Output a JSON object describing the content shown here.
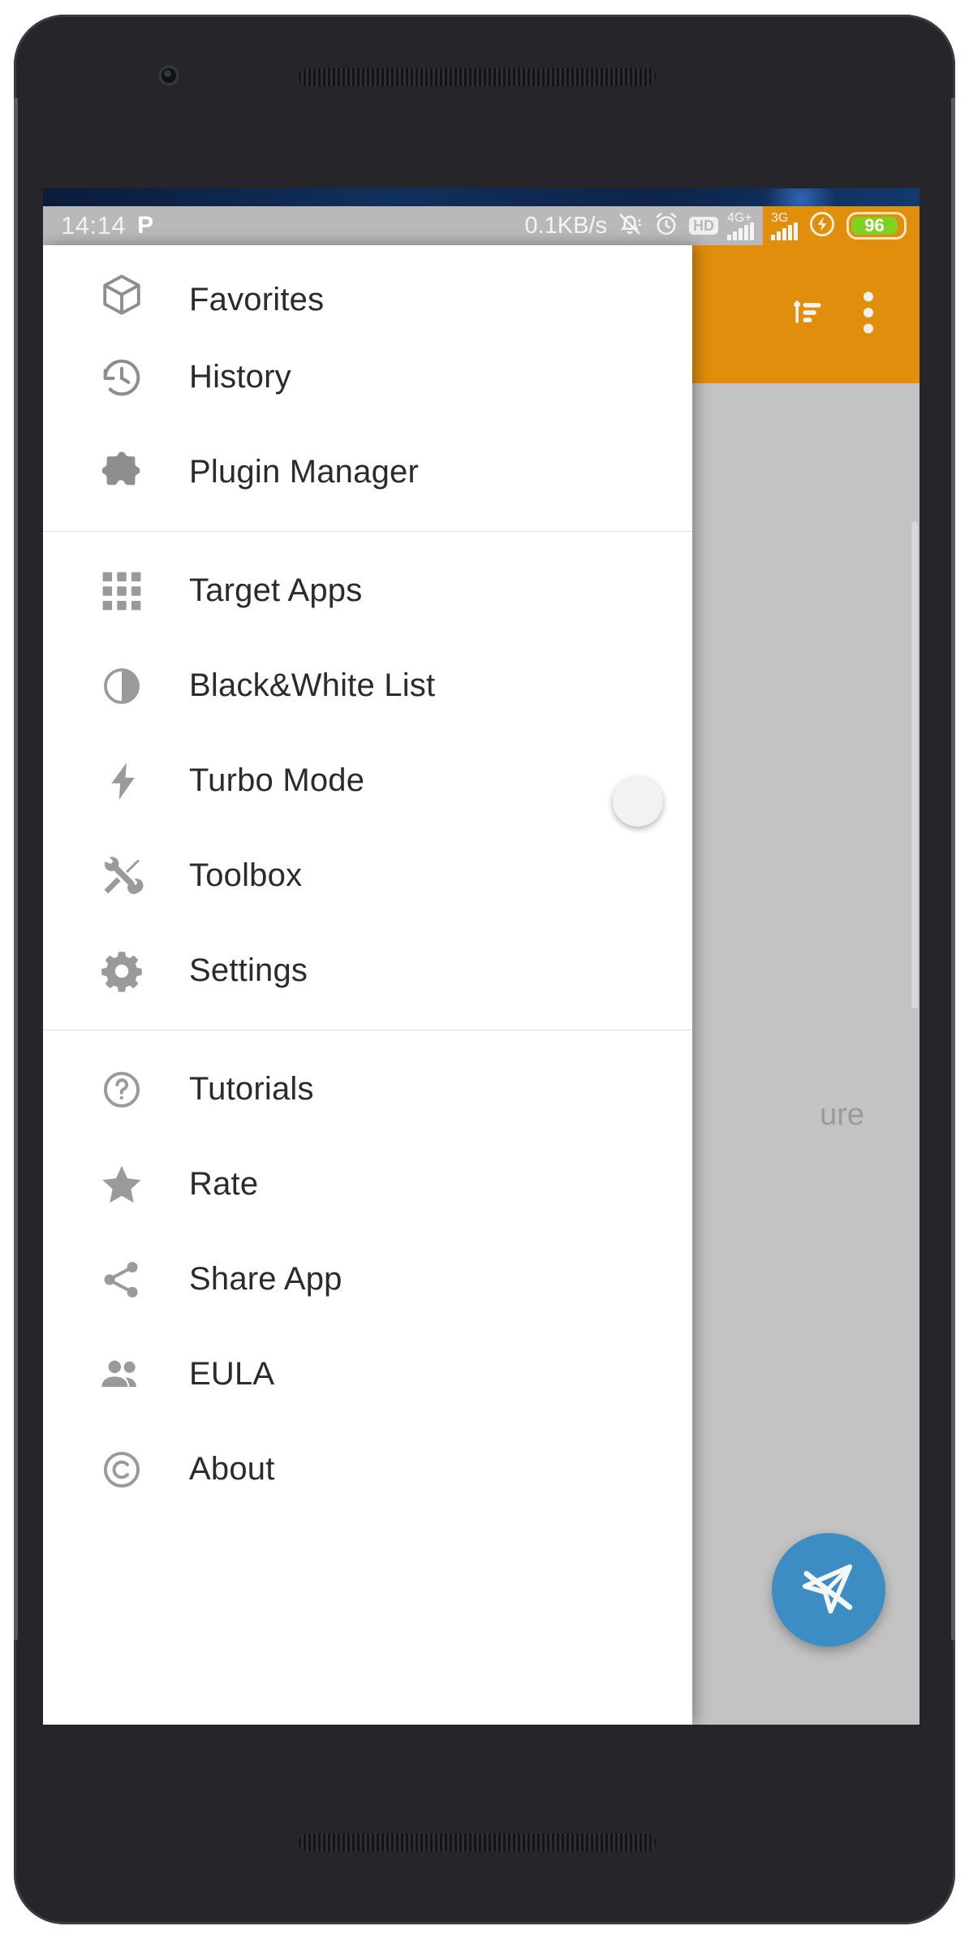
{
  "statusbar": {
    "time": "14:14",
    "pico_icon": "P",
    "network_speed": "0.1KB/s",
    "mute_icon": "bell-muted-icon",
    "alarm_icon": "alarm-clock-icon",
    "hd_label": "HD",
    "sim1_label": "4G+",
    "sim2_label": "3G",
    "charging_icon": "charging-bolt-icon",
    "battery_percent": "96",
    "battery_color": "#7ed321"
  },
  "appbar": {
    "background": "#e08e0b",
    "sort_icon": "sort-filter-icon",
    "overflow_icon": "more-vertical-icon"
  },
  "content": {
    "ghost_text": "ure",
    "fab_icon": "send-disabled-icon",
    "fab_color": "#3b8dc4"
  },
  "drawer": {
    "groups": [
      {
        "items": [
          {
            "label": "Favorites",
            "icon": "cube-icon"
          },
          {
            "label": "History",
            "icon": "history-clock-icon"
          },
          {
            "label": "Plugin Manager",
            "icon": "puzzle-piece-icon"
          }
        ]
      },
      {
        "items": [
          {
            "label": "Target Apps",
            "icon": "grid-apps-icon"
          },
          {
            "label": "Black&White List",
            "icon": "contrast-circle-icon"
          },
          {
            "label": "Turbo Mode",
            "icon": "lightning-bolt-icon",
            "toggle": "off"
          },
          {
            "label": "Toolbox",
            "icon": "tools-icon"
          },
          {
            "label": "Settings",
            "icon": "gear-icon"
          }
        ]
      },
      {
        "items": [
          {
            "label": "Tutorials",
            "icon": "help-circle-icon"
          },
          {
            "label": "Rate",
            "icon": "star-icon"
          },
          {
            "label": "Share App",
            "icon": "share-icon"
          },
          {
            "label": "EULA",
            "icon": "people-icon"
          },
          {
            "label": "About",
            "icon": "copyright-icon"
          }
        ]
      }
    ]
  }
}
